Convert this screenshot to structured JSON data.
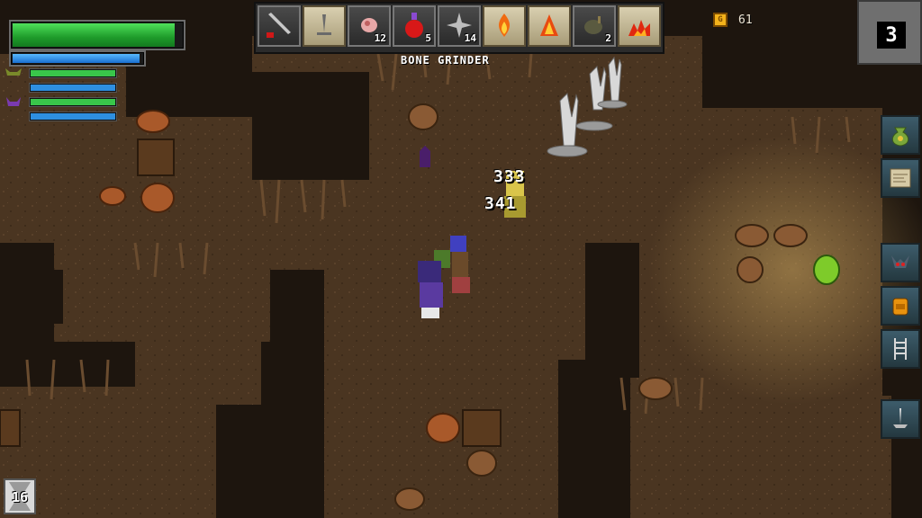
{
  "hud": {
    "health_fraction": 0.96,
    "mana_fraction": 0.98,
    "party": [
      {
        "icon": "goblin-icon",
        "fraction": 1.0,
        "color": "#39c64a"
      },
      {
        "icon": "goblin-icon",
        "fraction": 1.0,
        "color": "#2e8fe0"
      },
      {
        "icon": "imp-icon",
        "fraction": 1.0,
        "color": "#39c64a"
      },
      {
        "icon": "imp-icon",
        "fraction": 1.0,
        "color": "#2e8fe0"
      }
    ]
  },
  "hotbar": {
    "selected_label": "BONE GRINDER",
    "slots": [
      {
        "icon": "bone-grinder-weapon-icon",
        "count": ""
      },
      {
        "icon": "bone-spike-scroll-icon",
        "count": ""
      },
      {
        "icon": "meat-icon",
        "count": "12"
      },
      {
        "icon": "red-potion-icon",
        "count": "5"
      },
      {
        "icon": "shuriken-icon",
        "count": "14"
      },
      {
        "icon": "fire-scroll-icon",
        "count": ""
      },
      {
        "icon": "flame-burst-scroll-icon",
        "count": ""
      },
      {
        "icon": "bomb-icon",
        "count": "2"
      },
      {
        "icon": "flame-ground-scroll-icon",
        "count": ""
      }
    ]
  },
  "gold": {
    "icon": "coin-icon",
    "value": "61"
  },
  "level": {
    "value": "3"
  },
  "side_menu": [
    {
      "icon": "loot-bag-icon"
    },
    {
      "icon": "map-icon"
    },
    {
      "icon": "creature-icon"
    },
    {
      "icon": "backpack-icon"
    },
    {
      "icon": "ladder-icon"
    },
    {
      "icon": "bone-spike-icon"
    }
  ],
  "turn": {
    "icon": "hourglass-icon",
    "value": "16"
  },
  "damage_numbers": [
    "333",
    "341"
  ],
  "colors": {
    "health": "#2ecc40",
    "mana": "#2e8fe0",
    "gold": "#f3b21b",
    "dirt": "#4a3521",
    "wall": "#1d150e"
  }
}
